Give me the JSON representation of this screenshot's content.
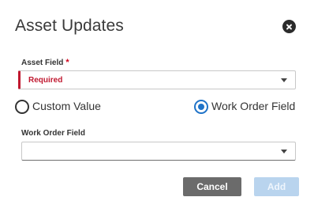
{
  "dialog": {
    "title": "Asset Updates",
    "close_icon": "close-circle-icon"
  },
  "asset_field": {
    "label": "Asset Field",
    "required_marker": "*",
    "value": "Required",
    "caret_icon": "caret-down-icon"
  },
  "source_options": [
    {
      "label": "Custom Value",
      "checked": false
    },
    {
      "label": "Work Order Field",
      "checked": true
    }
  ],
  "work_order_field": {
    "label": "Work Order Field",
    "value": "",
    "caret_icon": "caret-down-icon"
  },
  "buttons": {
    "cancel_label": "Cancel",
    "add_label": "Add",
    "add_enabled": false
  },
  "colors": {
    "error": "#c0182f",
    "accent": "#1f73c8",
    "cancel_bg": "#6b6b6b",
    "add_disabled_bg": "#b9d4ee"
  }
}
